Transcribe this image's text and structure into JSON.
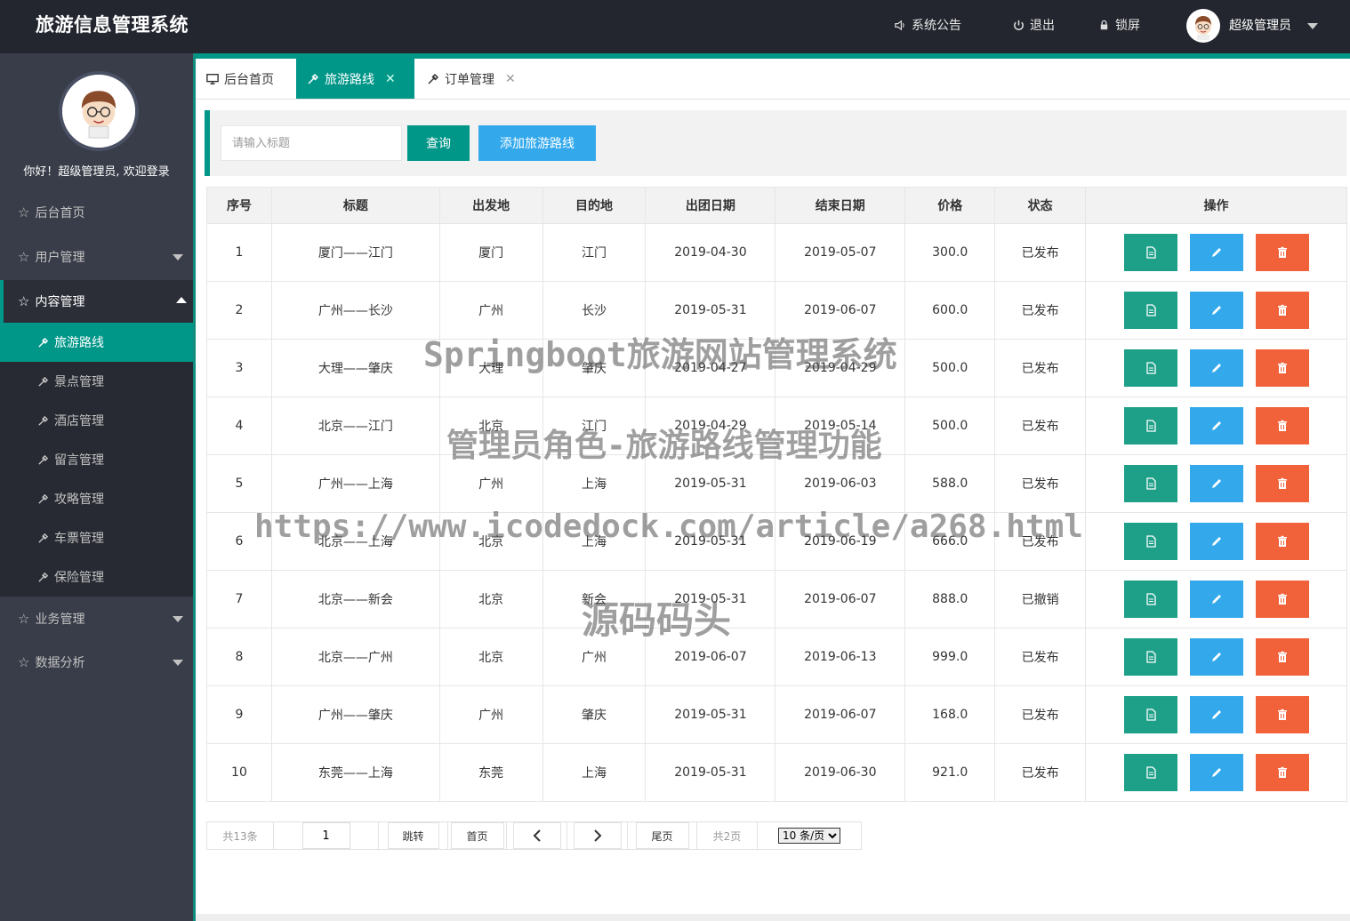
{
  "header": {
    "title": "旅游信息管理系统",
    "announce": "系统公告",
    "logout": "退出",
    "lock": "锁屏",
    "user_name": "超级管理员"
  },
  "sidebar": {
    "welcome": "你好！超级管理员, 欢迎登录",
    "items": [
      {
        "label": "后台首页"
      },
      {
        "label": "用户管理"
      },
      {
        "label": "内容管理"
      },
      {
        "label": "业务管理"
      },
      {
        "label": "数据分析"
      }
    ],
    "sub_items": [
      {
        "label": "旅游路线"
      },
      {
        "label": "景点管理"
      },
      {
        "label": "酒店管理"
      },
      {
        "label": "留言管理"
      },
      {
        "label": "攻略管理"
      },
      {
        "label": "车票管理"
      },
      {
        "label": "保险管理"
      }
    ]
  },
  "tabs": [
    {
      "label": "后台首页"
    },
    {
      "label": "旅游路线",
      "close": "✕"
    },
    {
      "label": "订单管理",
      "close": "✕"
    }
  ],
  "search": {
    "placeholder": "请输入标题",
    "query_label": "查询",
    "add_label": "添加旅游路线"
  },
  "table": {
    "headers": [
      "序号",
      "标题",
      "出发地",
      "目的地",
      "出团日期",
      "结束日期",
      "价格",
      "状态",
      "操作"
    ],
    "rows": [
      [
        "1",
        "厦门——江门",
        "厦门",
        "江门",
        "2019-04-30",
        "2019-05-07",
        "300.0",
        "已发布"
      ],
      [
        "2",
        "广州——长沙",
        "广州",
        "长沙",
        "2019-05-31",
        "2019-06-07",
        "600.0",
        "已发布"
      ],
      [
        "3",
        "大理——肇庆",
        "大理",
        "肇庆",
        "2019-04-27",
        "2019-04-29",
        "500.0",
        "已发布"
      ],
      [
        "4",
        "北京——江门",
        "北京",
        "江门",
        "2019-04-29",
        "2019-05-14",
        "500.0",
        "已发布"
      ],
      [
        "5",
        "广州——上海",
        "广州",
        "上海",
        "2019-05-31",
        "2019-06-03",
        "588.0",
        "已发布"
      ],
      [
        "6",
        "北京——上海",
        "北京",
        "上海",
        "2019-05-31",
        "2019-06-19",
        "666.0",
        "已发布"
      ],
      [
        "7",
        "北京——新会",
        "北京",
        "新会",
        "2019-05-31",
        "2019-06-07",
        "888.0",
        "已撤销"
      ],
      [
        "8",
        "北京——广州",
        "北京",
        "广州",
        "2019-06-07",
        "2019-06-13",
        "999.0",
        "已发布"
      ],
      [
        "9",
        "广州——肇庆",
        "广州",
        "肇庆",
        "2019-05-31",
        "2019-06-07",
        "168.0",
        "已发布"
      ],
      [
        "10",
        "东莞——上海",
        "东莞",
        "上海",
        "2019-05-31",
        "2019-06-30",
        "921.0",
        "已发布"
      ]
    ]
  },
  "pager": {
    "total": "共13条",
    "page_value": "1",
    "jump": "跳转",
    "first": "首页",
    "last": "尾页",
    "pages": "共2页",
    "page_size": "10 条/页"
  },
  "watermark": {
    "line1": "Springboot旅游网站管理系统",
    "line2": "管理员角色-旅游路线管理功能",
    "line3": "https://www.icodedock.com/article/a268.html",
    "line4": "源码码头"
  },
  "colors": {
    "header_bg": "#23262e",
    "sidebar_bg": "#393d49",
    "accent": "#009688",
    "blue": "#33a9ec",
    "orange": "#f2623a"
  },
  "icons": {
    "view": "document-icon",
    "edit": "pencil-icon",
    "delete": "trash-icon"
  }
}
